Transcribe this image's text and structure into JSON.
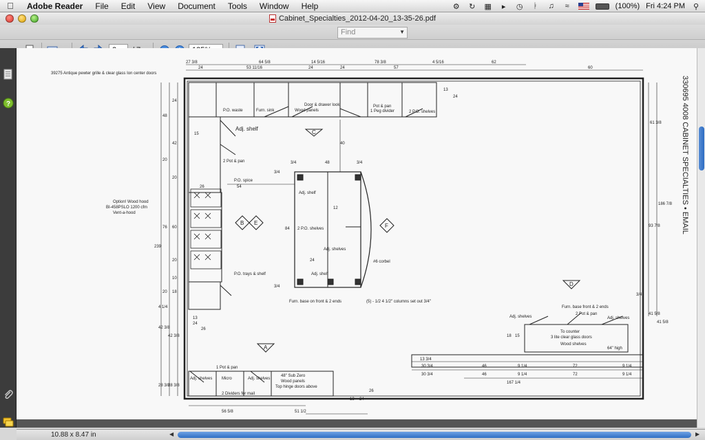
{
  "menubar": {
    "app_name": "Adobe Reader",
    "menus": [
      "File",
      "Edit",
      "View",
      "Document",
      "Tools",
      "Window",
      "Help"
    ],
    "battery": "(100%)",
    "clock": "Fri 4:24 PM"
  },
  "window": {
    "title": "Cabinet_Specialties_2012-04-20_13-35-26.pdf"
  },
  "find": {
    "placeholder": "Find"
  },
  "toolbar": {
    "page_number": "2",
    "page_total": "/ 7",
    "zoom": "125%"
  },
  "status": {
    "page_size": "10.88 x 8.47 in"
  },
  "drawing": {
    "header_note": "39275 Antique pewter grille & clear glass Ion center doors",
    "top_dims": [
      "27 3/8",
      "64 5/8",
      "14 5/16",
      "78 3/8",
      "4 5/16",
      "62",
      "24",
      "53 11/16",
      "24",
      "24",
      "57",
      "60"
    ],
    "top_notes": [
      "P.O. waste",
      "Furn. sink",
      "Door & drawer look",
      "Wood panels",
      "Pot & pan",
      "1 Peg divider",
      "2 P.O. shelves"
    ],
    "left_dims": [
      "24",
      "48",
      "42",
      "20",
      "20",
      "76",
      "60",
      "239",
      "20",
      "10",
      "18",
      "20",
      "4 1/4",
      "42 3/8",
      "42 3/8",
      "28 3/8",
      "28 3/8"
    ],
    "left_notes": [
      "15",
      "Adj. shelf",
      "2 Pot & pan",
      "P.O. spice",
      "26",
      "54",
      "Option! Wood hood",
      "BI-458PSLO 1200 cfm",
      "Vent-a-hood",
      "P.O. trays & shelf",
      "13",
      "24",
      "26"
    ],
    "island": [
      "3/4",
      "48",
      "3/4",
      "40",
      "Adj. shelf",
      "12",
      "2 P.O. shelves",
      "84",
      "3/4",
      "Adj. shelves",
      "24",
      "Adj. shelf",
      "#6 corbel",
      "3/4",
      "Furn. base on front & 2 ends",
      "(5) - 1/2 4 1/2\" columns set out 3/4\""
    ],
    "labels": [
      "C",
      "B",
      "E",
      "F",
      "D",
      "A"
    ],
    "right_dims": [
      "13",
      "24",
      "61 3/8",
      "186 7/8",
      "93 7/8",
      "41 5/8",
      "41 5/8",
      "3/4"
    ],
    "right_notes": [
      "Furn. base front & 2 ends",
      "Adj. shelves",
      "2 Pot & pan",
      "Adj. shelves",
      "To counter",
      "3 lite clear glass doors",
      "Wood shelves",
      "64\" high",
      "18",
      "15"
    ],
    "bottom_dims": [
      "13 3/4",
      "30 3/4",
      "46",
      "9 1/4",
      "72",
      "9 1/4",
      "30 3/4",
      "46",
      "9 1/4",
      "72",
      "9 1/4",
      "167 1/4",
      "13",
      "24",
      "26",
      "56 5/8",
      "51 1/2"
    ],
    "bottom_notes": [
      "1 Pot & pan",
      "Adj. shelves",
      "Micro",
      "Adj. shelves",
      "2 Dividers for mail",
      "48\" Sub Zero",
      "Wood panels",
      "Top hinge doors above"
    ],
    "side_text": "330695 4008 CABINET SPECIALTIES • EMAIL"
  }
}
